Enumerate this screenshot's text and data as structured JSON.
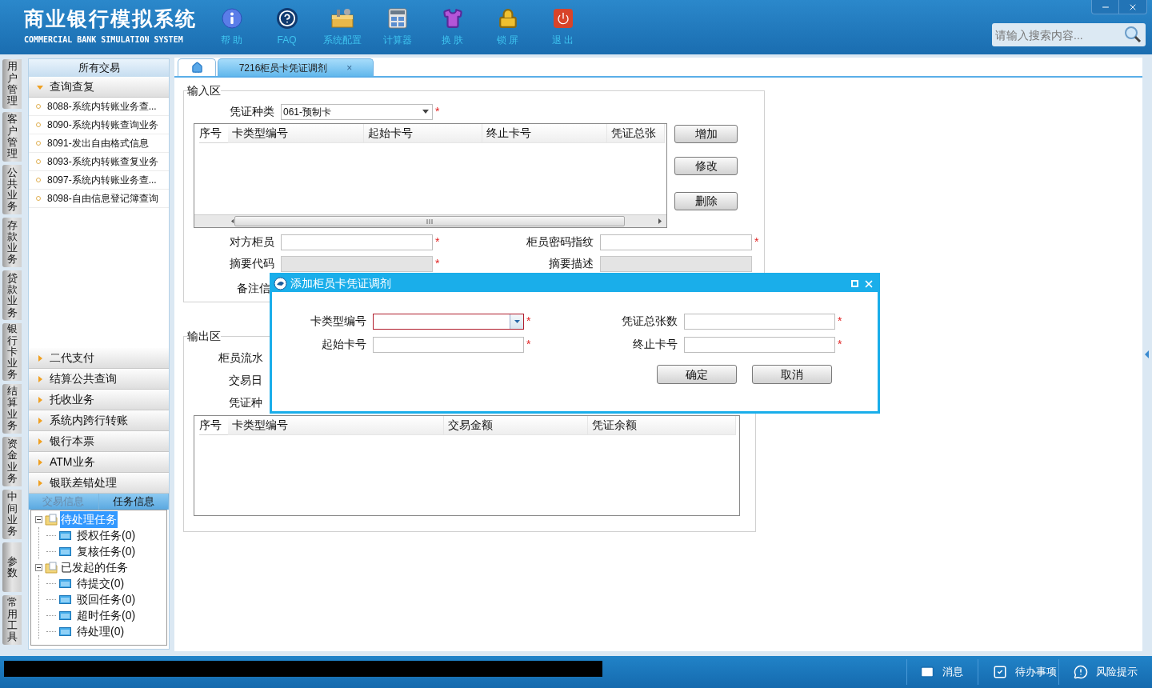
{
  "header": {
    "title": "商业银行模拟系统",
    "subtitle": "COMMERCIAL BANK SIMULATION SYSTEM",
    "toolbar": [
      {
        "label": "帮 助"
      },
      {
        "label": "FAQ"
      },
      {
        "label": "系统配置"
      },
      {
        "label": "计算器"
      },
      {
        "label": "换 肤"
      },
      {
        "label": "锁 屏"
      },
      {
        "label": "退 出"
      }
    ],
    "search": {
      "placeholder": "请输入搜索内容..."
    }
  },
  "side_tabs": [
    {
      "label": "用户管理"
    },
    {
      "label": "客户管理"
    },
    {
      "label": "公共业务"
    },
    {
      "label": "存款业务"
    },
    {
      "label": "贷款业务"
    },
    {
      "label": "银行卡业务"
    },
    {
      "label": "结算业务"
    },
    {
      "label": "资金业务"
    },
    {
      "label": "中间业务"
    },
    {
      "label": "参数"
    },
    {
      "label": "常用工具"
    }
  ],
  "sidebar": {
    "title": "所有交易",
    "sections": [
      {
        "label": "查询查复",
        "expanded": true,
        "items": [
          {
            "label": "8088-系统内转账业务查..."
          },
          {
            "label": "8090-系统内转账查询业务"
          },
          {
            "label": "8091-发出自由格式信息"
          },
          {
            "label": "8093-系统内转账查复业务"
          },
          {
            "label": "8097-系统内转账业务查..."
          },
          {
            "label": "8098-自由信息登记簿查询"
          }
        ]
      },
      {
        "label": "二代支付",
        "expanded": false
      },
      {
        "label": "结算公共查询",
        "expanded": false
      },
      {
        "label": "托收业务",
        "expanded": false
      },
      {
        "label": "系统内跨行转账",
        "expanded": false
      },
      {
        "label": "银行本票",
        "expanded": false
      },
      {
        "label": "ATM业务",
        "expanded": false
      },
      {
        "label": "银联差错处理",
        "expanded": false
      }
    ],
    "bottom_tabs": [
      {
        "label": "交易信息",
        "selected": false
      },
      {
        "label": "任务信息",
        "selected": true
      }
    ],
    "tree": [
      {
        "label": "待处理任务",
        "selected": true,
        "expanded": true,
        "children": [
          {
            "label": "授权任务(0)",
            "selected": false
          },
          {
            "label": "复核任务(0)",
            "selected": false
          }
        ]
      },
      {
        "label": "已发起的任务",
        "selected": false,
        "expanded": true,
        "children": [
          {
            "label": "待提交(0)",
            "selected": false
          },
          {
            "label": "驳回任务(0)",
            "selected": false
          },
          {
            "label": "超时任务(0)",
            "selected": false
          },
          {
            "label": "待处理(0)",
            "selected": false
          }
        ]
      }
    ]
  },
  "tabs": [
    {
      "kind": "home",
      "selected": false
    },
    {
      "kind": "page",
      "label": "7216柜员卡凭证调剂",
      "close": "×",
      "selected": true
    }
  ],
  "required_mark": "*",
  "input_area": {
    "legend": "输入区",
    "voucher_type": {
      "label": "凭证种类",
      "value": "061-预制卡",
      "required": true
    },
    "table": {
      "columns": [
        "序号",
        "卡类型编号",
        "起始卡号",
        "终止卡号",
        "凭证总张"
      ]
    },
    "buttons": [
      "增加",
      "修改",
      "删除"
    ],
    "fields": [
      {
        "label": "对方柜员",
        "required": true,
        "disabled": false
      },
      {
        "label": "柜员密码指纹",
        "required": true,
        "disabled": false
      },
      {
        "label": "摘要代码",
        "required": true,
        "disabled": true
      },
      {
        "label": "摘要描述",
        "required": false,
        "disabled": true
      }
    ],
    "note_label": "备注信"
  },
  "output_area": {
    "legend": "输出区",
    "labels": [
      "柜员流水",
      "交易日",
      "凭证种"
    ],
    "table": {
      "columns": [
        "序号",
        "卡类型编号",
        "交易金额",
        "凭证余额"
      ]
    }
  },
  "dialog": {
    "title": "添加柜员卡凭证调剂",
    "fields": [
      {
        "label": "卡类型编号",
        "kind": "select",
        "required": true,
        "focused": true
      },
      {
        "label": "凭证总张数",
        "kind": "text",
        "required": true,
        "focused": false
      },
      {
        "label": "起始卡号",
        "kind": "text",
        "required": true,
        "focused": false
      },
      {
        "label": "终止卡号",
        "kind": "text",
        "required": true,
        "focused": false
      }
    ],
    "buttons": [
      "确定",
      "取消"
    ]
  },
  "status_bar": {
    "items": [
      {
        "label": "消息"
      },
      {
        "label": "待办事项"
      },
      {
        "label": "风险提示"
      }
    ]
  }
}
